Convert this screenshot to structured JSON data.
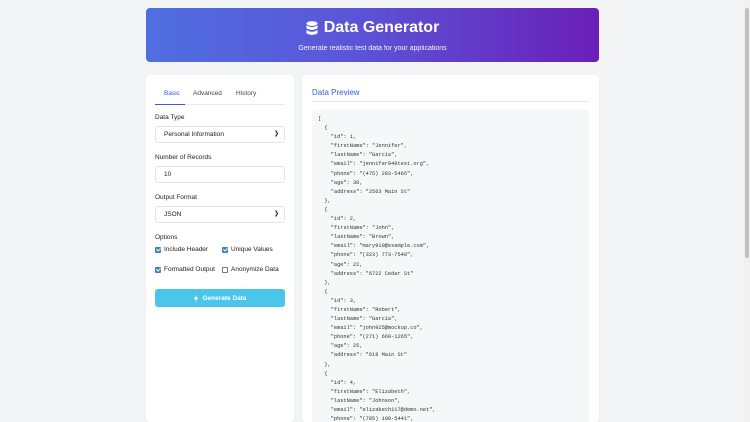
{
  "header": {
    "title": "Data Generator",
    "subtitle": "Generate realistic test data for your applications"
  },
  "tabs": [
    {
      "label": "Basic",
      "active": true
    },
    {
      "label": "Advanced",
      "active": false
    },
    {
      "label": "History",
      "active": false
    }
  ],
  "form": {
    "data_type_label": "Data Type",
    "data_type_value": "Personal Information",
    "records_label": "Number of Records",
    "records_value": "10",
    "format_label": "Output Format",
    "format_value": "JSON",
    "options_label": "Options",
    "options": [
      {
        "label": "Include Header",
        "checked": true
      },
      {
        "label": "Unique Values",
        "checked": true
      },
      {
        "label": "Formatted Output",
        "checked": true
      },
      {
        "label": "Anonymize Data",
        "checked": false
      }
    ],
    "generate_label": "Generate Data"
  },
  "preview": {
    "title": "Data Preview",
    "code": "[\n  {\n    \"id\": 1,\n    \"firstName\": \"Jennifer\",\n    \"lastName\": \"Garcia\",\n    \"email\": \"jennifer949test.org\",\n    \"phone\": \"(475) 203-5466\",\n    \"age\": 30,\n    \"address\": \"2563 Main St\"\n  },\n  {\n    \"id\": 2,\n    \"firstName\": \"John\",\n    \"lastName\": \"Brown\",\n    \"email\": \"mary910@example.com\",\n    \"phone\": \"(323) 773-7548\",\n    \"age\": 22,\n    \"address\": \"6722 Cedar St\"\n  },\n  {\n    \"id\": 3,\n    \"firstName\": \"Robert\",\n    \"lastName\": \"Garcia\",\n    \"email\": \"john925@mockup.co\",\n    \"phone\": \"(271) 669-1265\",\n    \"age\": 25,\n    \"address\": \"618 Main St\"\n  },\n  {\n    \"id\": 4,\n    \"firstName\": \"Elizabeth\",\n    \"lastName\": \"Johnson\",\n    \"email\": \"elizabeth117@demo.net\",\n    \"phone\": \"(785) 108-5441\","
  }
}
